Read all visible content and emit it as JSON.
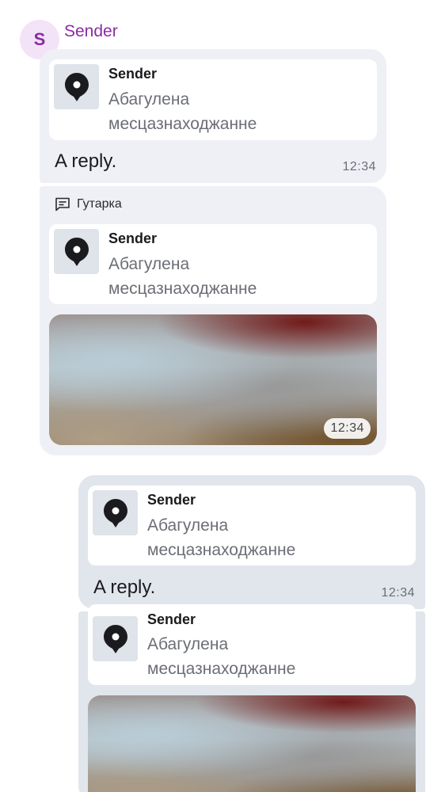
{
  "sender": {
    "initial": "S",
    "name": "Sender"
  },
  "messages": [
    {
      "quote": {
        "sender": "Sender",
        "text": "Абагулена месцазнаходжанне"
      },
      "reply": "A reply.",
      "time": "12:34"
    },
    {
      "thread_label": "Гутарка",
      "quote": {
        "sender": "Sender",
        "text": "Абагулена месцазнаходжанне"
      },
      "media_time": "12:34"
    },
    {
      "quote": {
        "sender": "Sender",
        "text": "Абагулена месцазнаходжанне"
      },
      "reply": "A reply.",
      "time": "12:34"
    },
    {
      "quote": {
        "sender": "Sender",
        "text": "Абагулена месцазнаходжанне"
      }
    }
  ],
  "icons": {
    "location": "location-pin-icon",
    "thread": "thread-icon"
  },
  "colors": {
    "sender_accent": "#8a2ba3",
    "incoming_bubble": "#eef0f5",
    "outgoing_bubble": "#e1e5ec"
  }
}
